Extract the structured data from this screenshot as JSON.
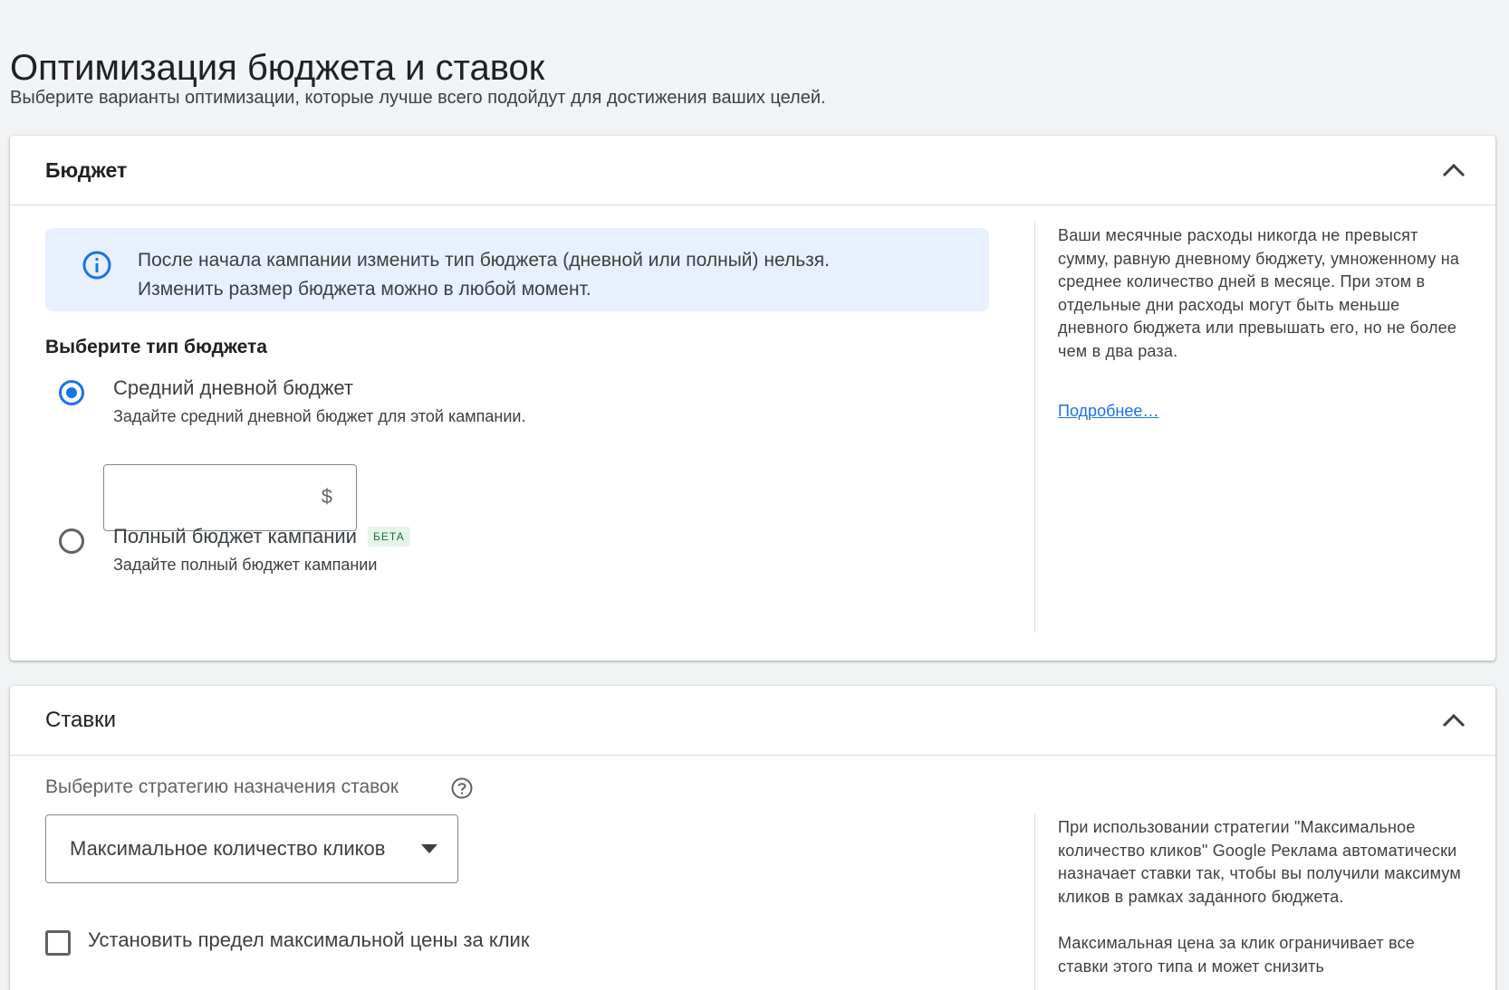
{
  "page": {
    "title": "Оптимизация бюджета и ставок",
    "subtitle": "Выберите варианты оптимизации, которые лучше всего подойдут для достижения ваших целей."
  },
  "budget": {
    "title": "Бюджет",
    "notice": {
      "icon": "info-icon",
      "line1": "После начала кампании изменить тип бюджета (дневной или полный) нельзя.",
      "line2": "Изменить размер бюджета можно в любой момент."
    },
    "type_label": "Выберите тип бюджета",
    "options": [
      {
        "label": "Средний дневной бюджет",
        "description": "Задайте средний дневной бюджет для этой кампании.",
        "selected": true
      },
      {
        "label": "Полный бюджет кампании",
        "badge": "БЕТА",
        "description": "Задайте полный бюджет кампании",
        "selected": false
      }
    ],
    "amount_input": {
      "value": "",
      "currency": "$"
    },
    "sidebar": {
      "text": "Ваши месячные расходы никогда не превысят сумму, равную дневному бюджету, умноженному на среднее количество дней в месяце. При этом в отдельные дни расходы могут быть меньше дневного бюджета или превышать его, но не более чем в два раза.",
      "link": "Подробнее…"
    }
  },
  "bids": {
    "title": "Ставки",
    "strategy_label": "Выберите стратегию назначения ставок",
    "strategy_value": "Максимальное количество кликов",
    "max_cpc_checkbox": {
      "label": "Установить предел максимальной цены за клик",
      "checked": false
    },
    "sidebar": {
      "paragraph1": "При использовании стратегии \"Максимальное количество кликов\" Google Реклама автоматически назначает ставки так, чтобы вы получили максимум кликов в рамках заданного бюджета.",
      "paragraph2": "Максимальная цена за клик ограничивает все ставки этого типа и может снизить"
    }
  },
  "colors": {
    "accent": "#1a73e8",
    "notice_bg": "#e8f0fe",
    "beta_bg": "#e6f4ea",
    "beta_text": "#137333",
    "background": "#f1f3f4"
  }
}
